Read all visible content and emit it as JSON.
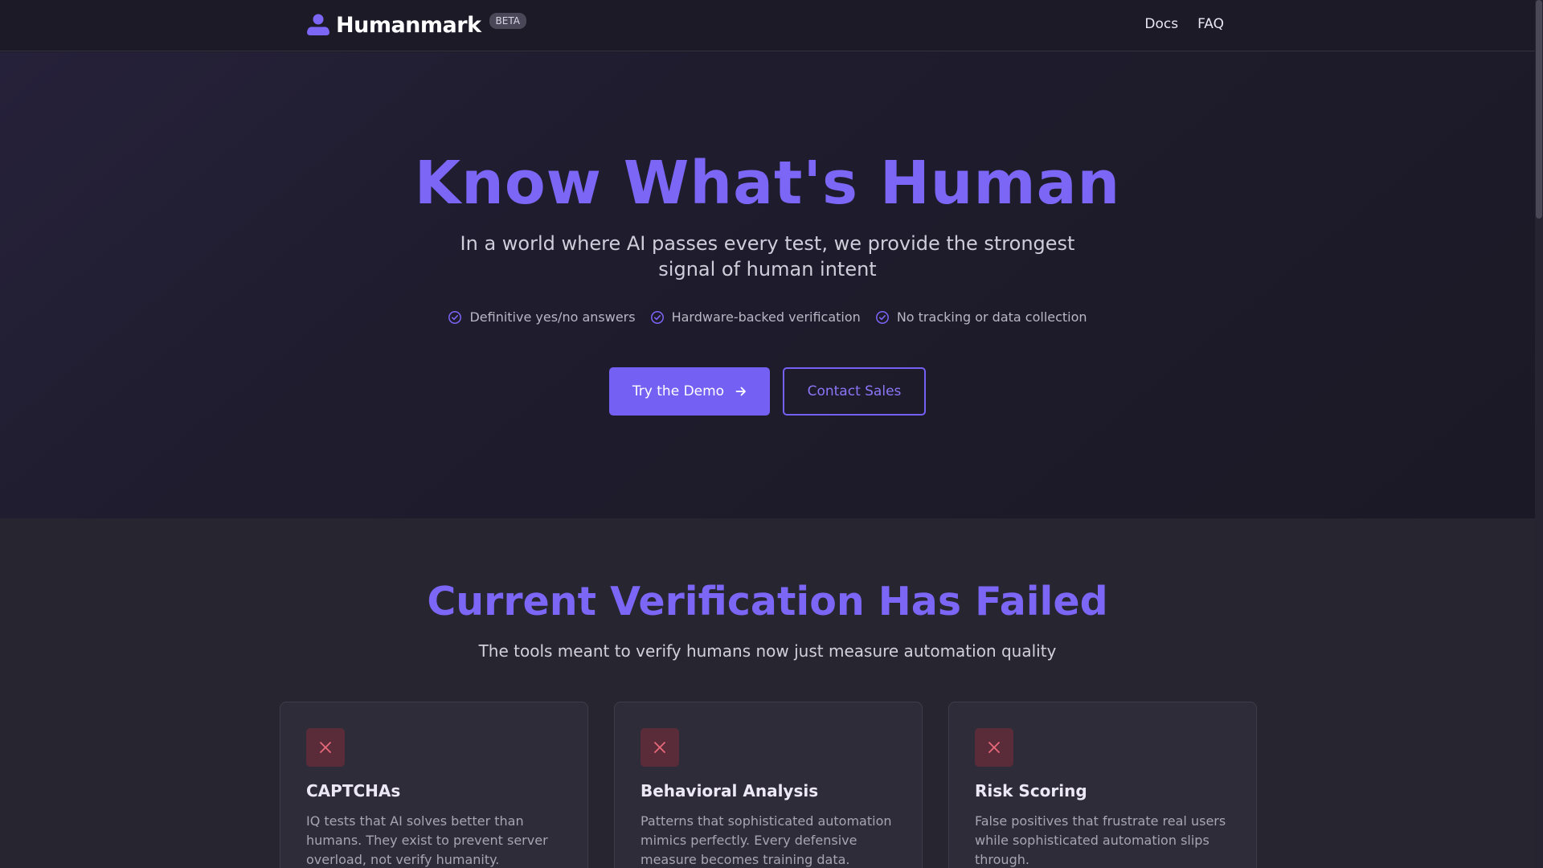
{
  "navbar": {
    "brand_name": "Humanmark",
    "beta_label": "BETA",
    "links": [
      "Docs",
      "FAQ"
    ]
  },
  "hero": {
    "title": "Know What's Human",
    "subtitle": "In a world where AI passes every test, we provide the strongest signal of human intent",
    "features": [
      "Definitive yes/no answers",
      "Hardware-backed verification",
      "No tracking or data collection"
    ],
    "primary_button": "Try the Demo",
    "secondary_button": "Contact Sales"
  },
  "problems": {
    "title": "Current Verification Has Failed",
    "subtitle": "The tools meant to verify humans now just measure automation quality",
    "cards": [
      {
        "title": "CAPTCHAs",
        "description": "IQ tests that AI solves better than humans. They exist to prevent server overload, not verify humanity."
      },
      {
        "title": "Behavioral Analysis",
        "description": "Patterns that sophisticated automation mimics perfectly. Every defensive measure becomes training data."
      },
      {
        "title": "Risk Scoring",
        "description": "False positives that frustrate real users while sophisticated automation slips through."
      }
    ]
  },
  "colors": {
    "accent": "#7460f2",
    "heading": "#7b66f5",
    "danger_icon_bg": "#5a2c3a",
    "danger_icon": "#e86a7a"
  },
  "icons": {
    "brand": "person-logo-icon",
    "feature": "check-circle-icon",
    "button": "arrow-right-icon",
    "card": "close-x-icon"
  }
}
